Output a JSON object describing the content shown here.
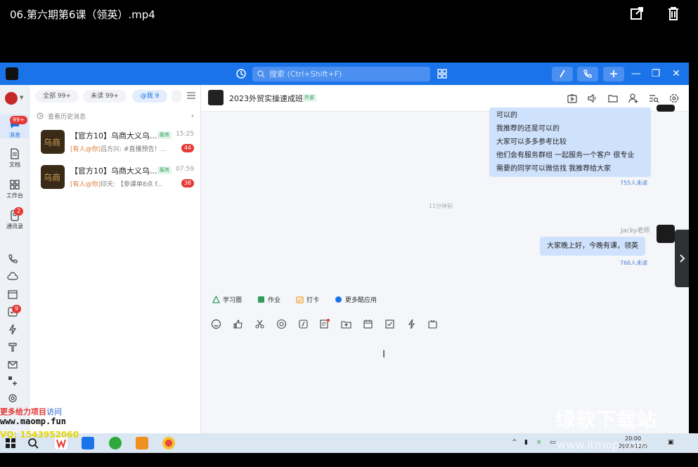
{
  "player": {
    "title": "06.第六期第6课（领英）.mp4"
  },
  "titlebar": {
    "search_placeholder": "搜索 (Ctrl+Shift+F)",
    "win_min": "—",
    "win_restore": "❐",
    "win_close": "✕"
  },
  "rail": {
    "items": [
      {
        "label": "消息",
        "badge": "99+"
      },
      {
        "label": "文档"
      },
      {
        "label": "工作台"
      },
      {
        "label": "通讯录",
        "badge": "2"
      }
    ],
    "mail_badge": "9"
  },
  "list": {
    "filters": [
      {
        "label": "全部 99+"
      },
      {
        "label": "未读 99+"
      },
      {
        "label": "@我 9"
      }
    ],
    "history_link": "查看历史消息",
    "conversations": [
      {
        "name": "【官方10】乌商大义乌...",
        "tag": "服务",
        "time": "15:25",
        "mention": "[有人@你]",
        "preview": "吕方兴: #直播预告！...",
        "count": "44",
        "avatar_text": "乌商"
      },
      {
        "name": "【官方10】乌商大义乌...",
        "tag": "服务",
        "time": "07:59",
        "mention": "[有人@你]",
        "preview": "印天: 【参课单8点 f...",
        "count": "38",
        "avatar_text": "乌商"
      }
    ]
  },
  "chat": {
    "title": "2023外贸实操速成班",
    "title_tag": "外部",
    "messages": [
      {
        "lines": [
          "可以的",
          "我推荐的还是可以的",
          "大家可以多多参考比较",
          "他们会有服务群组 一起服务一个客户 很专业",
          "需要的同学可以微信找 我推荐给大家"
        ],
        "read": "755人未读"
      },
      {
        "sender": "Jacky老师",
        "lines": [
          "大家晚上好，今晚有课，领英"
        ],
        "read": "766人未读"
      }
    ],
    "divider": "11分钟前",
    "apps": [
      {
        "label": "学习圈"
      },
      {
        "label": "作业"
      },
      {
        "label": "打卡"
      },
      {
        "label": "更多酷应用"
      }
    ],
    "cursor": "I"
  },
  "taskbar": {
    "clock_time": "20:00",
    "clock_date": "2023/12/5"
  },
  "watermarks": {
    "site_line": "更多给力项目",
    "site_visit": "访问",
    "url": "www.maomp.fun",
    "qq": "VQ: 1543952060",
    "brand": "绿软下载站",
    "brand_url": "www.itmop.com"
  },
  "colors": {
    "accent": "#1a73e8",
    "bubble": "#cfe2fd",
    "badge": "#e53935"
  }
}
